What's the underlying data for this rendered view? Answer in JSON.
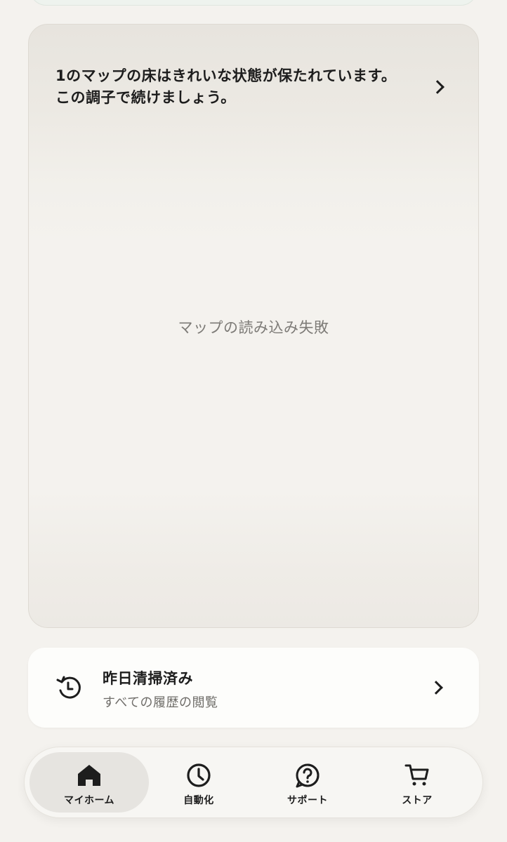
{
  "map_card": {
    "message": "1のマップの床はきれいな状態が保たれています。この調子で続けましょう。",
    "error_text": "マップの読み込み失敗"
  },
  "history_card": {
    "title": "昨日清掃済み",
    "subtitle": "すべての履歴の閲覧",
    "icon": "history-icon"
  },
  "bottom_nav": {
    "items": [
      {
        "label": "マイホーム",
        "icon": "home-icon",
        "active": true
      },
      {
        "label": "自動化",
        "icon": "clock-icon",
        "active": false
      },
      {
        "label": "サポート",
        "icon": "help-icon",
        "active": false
      },
      {
        "label": "ストア",
        "icon": "cart-icon",
        "active": false
      }
    ]
  }
}
